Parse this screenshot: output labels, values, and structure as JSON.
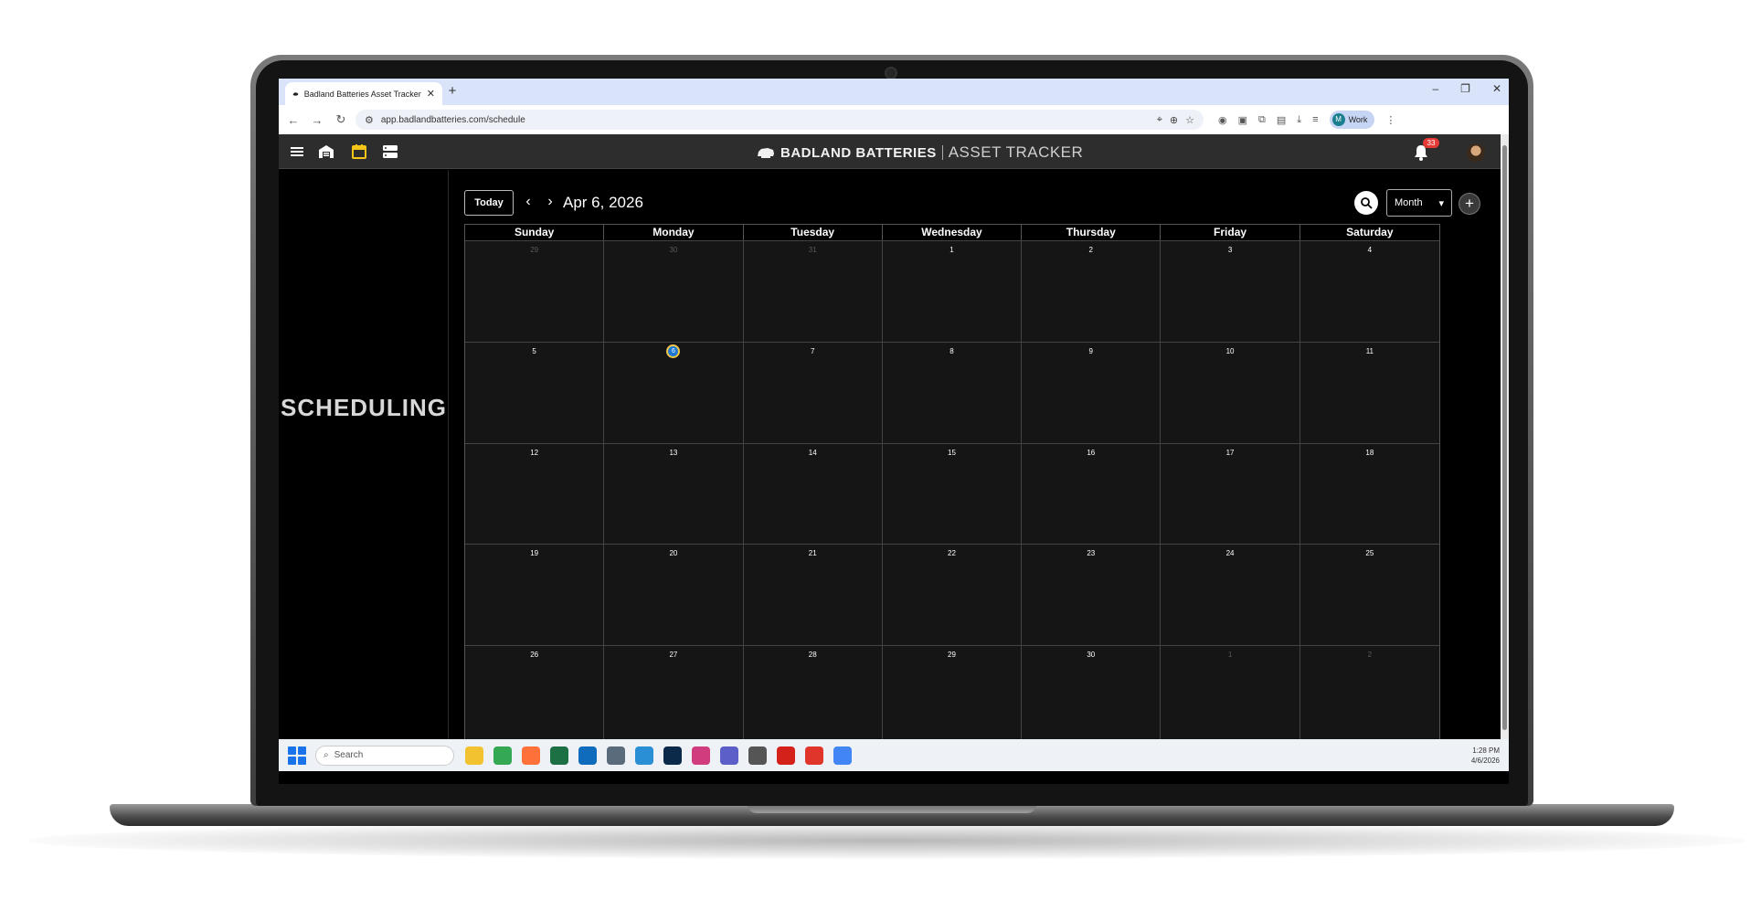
{
  "browser": {
    "tab_title": "Badland Batteries Asset Tracker",
    "tab_close": "✕",
    "new_tab": "+",
    "window_controls": [
      "–",
      "❐",
      "✕"
    ],
    "url": "app.badlandbatteries.com/schedule",
    "profile_initial": "M",
    "profile_label": "Work"
  },
  "header": {
    "brand_bold": "BADLAND BATTERIES",
    "brand_light": "ASSET TRACKER",
    "notification_count": "33",
    "icons": [
      "menu-icon",
      "warehouse-icon",
      "calendar-icon",
      "server-icon",
      "bell-icon"
    ],
    "active_color": "#f5c518"
  },
  "sidebar": {
    "title": "SCHEDULING"
  },
  "toolbar": {
    "today_label": "Today",
    "prev_label": "‹",
    "next_label": "›",
    "current_date": "Apr 6, 2026",
    "view_label": "Month",
    "add_label": "+"
  },
  "calendar": {
    "weekdays": [
      "Sunday",
      "Monday",
      "Tuesday",
      "Wednesday",
      "Thursday",
      "Friday",
      "Saturday"
    ],
    "weeks": [
      [
        "29",
        "30",
        "31",
        "1",
        "2",
        "3",
        "4"
      ],
      [
        "5",
        "6",
        "7",
        "8",
        "9",
        "10",
        "11"
      ],
      [
        "12",
        "13",
        "14",
        "15",
        "16",
        "17",
        "18"
      ],
      [
        "19",
        "20",
        "21",
        "22",
        "23",
        "24",
        "25"
      ],
      [
        "26",
        "27",
        "28",
        "29",
        "30",
        "1",
        "2"
      ]
    ],
    "outside_month": [
      [
        0,
        0
      ],
      [
        0,
        1
      ],
      [
        0,
        2
      ],
      [
        4,
        5
      ],
      [
        4,
        6
      ]
    ],
    "today": [
      1,
      1
    ],
    "today_color": "#1e78d2"
  },
  "taskbar": {
    "search_placeholder": "Search",
    "time": "1:28 PM",
    "date": "4/6/2026",
    "apps": [
      {
        "name": "file-explorer-icon",
        "color": "#f2c230"
      },
      {
        "name": "chrome-work-icon",
        "color": "#34a853"
      },
      {
        "name": "firefox-icon",
        "color": "#ff7139"
      },
      {
        "name": "excel-icon",
        "color": "#1d7044"
      },
      {
        "name": "outlook-icon",
        "color": "#0f6cbd"
      },
      {
        "name": "calculator-icon",
        "color": "#5a6b7b"
      },
      {
        "name": "notepad-icon",
        "color": "#2b8fd6"
      },
      {
        "name": "photoshop-icon",
        "color": "#0b2a4a"
      },
      {
        "name": "snipping-tool-icon",
        "color": "#d13c7f"
      },
      {
        "name": "teams-icon",
        "color": "#5b5fc7"
      },
      {
        "name": "printer-icon",
        "color": "#555555"
      },
      {
        "name": "acrobat-icon",
        "color": "#d4221b"
      },
      {
        "name": "acrobat-reader-icon",
        "color": "#e0352b"
      },
      {
        "name": "chrome-icon",
        "color": "#4285f4"
      }
    ]
  }
}
